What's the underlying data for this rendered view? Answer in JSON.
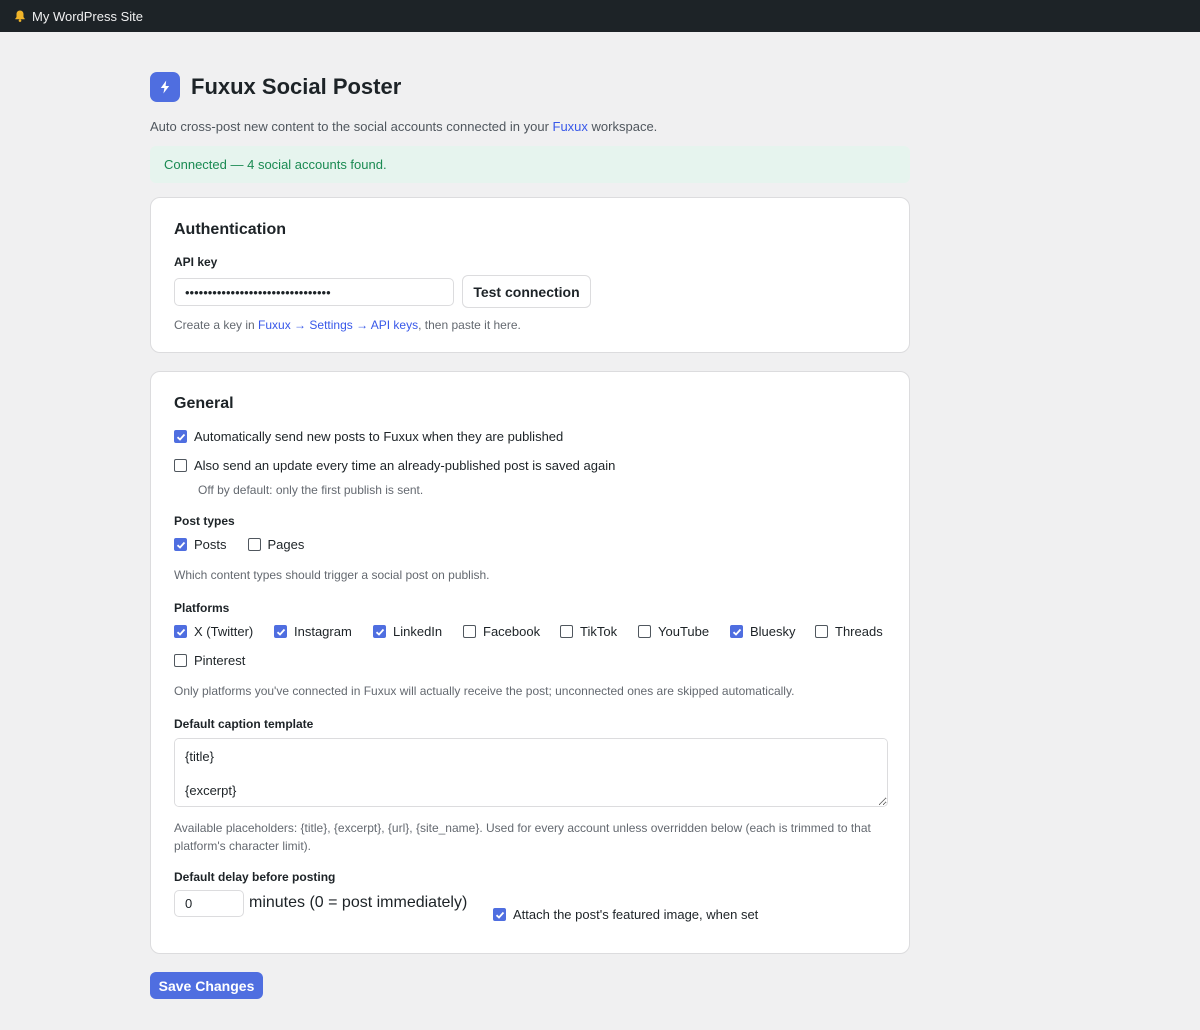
{
  "adminbar": {
    "site_name": "My WordPress Site"
  },
  "header": {
    "title": "Fuxux Social Poster",
    "subtitle_before": "Auto cross-post new content to the social accounts connected in your ",
    "subtitle_link": "Fuxux",
    "subtitle_after": " workspace."
  },
  "notice": {
    "text": "Connected — 4 social accounts found."
  },
  "auth": {
    "heading": "Authentication",
    "api_key_label": "API key",
    "api_key_value": "••••••••••••••••••••••••••••••••",
    "test_button": "Test connection",
    "help_before": "Create a key in ",
    "help_link": "Fuxux → Settings → API keys",
    "help_after": ", then paste it here."
  },
  "general": {
    "heading": "General",
    "auto_send_label": "Automatically send new posts to Fuxux when they are published",
    "auto_send_checked": true,
    "update_label": "Also send an update every time an already-published post is saved again",
    "update_checked": false,
    "update_help": "Off by default: only the first publish is sent.",
    "post_types_label": "Post types",
    "post_types": [
      {
        "label": "Posts",
        "checked": true
      },
      {
        "label": "Pages",
        "checked": false
      }
    ],
    "post_types_help": "Which content types should trigger a social post on publish.",
    "platforms_label": "Platforms",
    "platforms": [
      {
        "label": "X (Twitter)",
        "checked": true
      },
      {
        "label": "Instagram",
        "checked": true
      },
      {
        "label": "LinkedIn",
        "checked": true
      },
      {
        "label": "Facebook",
        "checked": false
      },
      {
        "label": "TikTok",
        "checked": false
      },
      {
        "label": "YouTube",
        "checked": false
      },
      {
        "label": "Bluesky",
        "checked": true
      },
      {
        "label": "Threads",
        "checked": false
      },
      {
        "label": "Pinterest",
        "checked": false
      }
    ],
    "platforms_help": "Only platforms you've connected in Fuxux will actually receive the post; unconnected ones are skipped automatically.",
    "caption_label": "Default caption template",
    "caption_value": "{title}\n\n{excerpt}",
    "caption_help_line1": "Available placeholders: {title}, {excerpt}, {url}, {site_name}. Used for every account unless overridden below (each is trimmed to that",
    "caption_help_line2": "platform's character limit).",
    "delay_label": "Default delay before posting",
    "delay_value": "0",
    "delay_suffix": "minutes (0 = post immediately)",
    "attach_label": "Attach the post's featured image, when set",
    "attach_checked": true
  },
  "save_button": "Save Changes",
  "colors": {
    "accent": "#4f6ee0",
    "success_bg": "#e6f4ee",
    "success_text": "#1a8a52",
    "adminbar": "#1d2327"
  }
}
